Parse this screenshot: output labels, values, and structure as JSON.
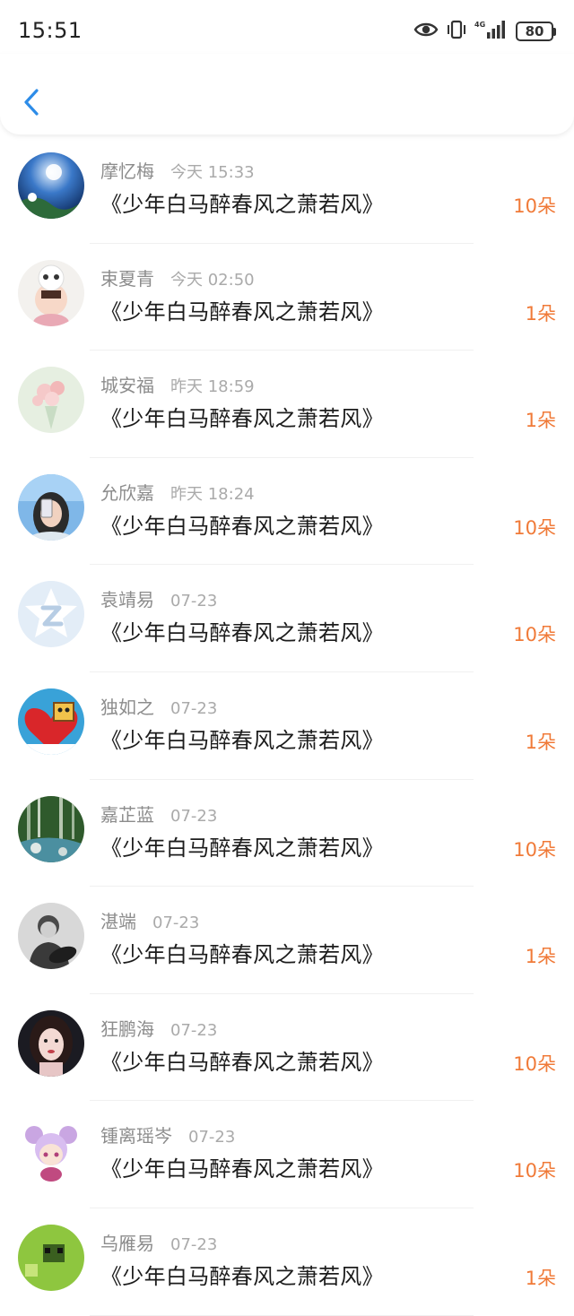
{
  "status_bar": {
    "time": "15:51",
    "battery": "80",
    "network": "4G"
  },
  "colors": {
    "accent_back": "#2d8ce8",
    "gift_count": "#f07a38",
    "meta_text": "#8c8c8c"
  },
  "nav": {
    "back_icon": "chevron-left-icon"
  },
  "items": [
    {
      "name": "摩忆梅",
      "time": "今天 15:33",
      "title": "《少年白马醉春风之萧若风》",
      "count": "10朵"
    },
    {
      "name": "束夏青",
      "time": "今天 02:50",
      "title": "《少年白马醉春风之萧若风》",
      "count": "1朵"
    },
    {
      "name": "城安福",
      "time": "昨天 18:59",
      "title": "《少年白马醉春风之萧若风》",
      "count": "1朵"
    },
    {
      "name": "允欣嘉",
      "time": "昨天 18:24",
      "title": "《少年白马醉春风之萧若风》",
      "count": "10朵"
    },
    {
      "name": "袁靖易",
      "time": "07-23",
      "title": "《少年白马醉春风之萧若风》",
      "count": "10朵"
    },
    {
      "name": "独如之",
      "time": "07-23",
      "title": "《少年白马醉春风之萧若风》",
      "count": "1朵"
    },
    {
      "name": "嘉芷蓝",
      "time": "07-23",
      "title": "《少年白马醉春风之萧若风》",
      "count": "10朵"
    },
    {
      "name": "湛端",
      "time": "07-23",
      "title": "《少年白马醉春风之萧若风》",
      "count": "1朵"
    },
    {
      "name": "狂鹏海",
      "time": "07-23",
      "title": "《少年白马醉春风之萧若风》",
      "count": "10朵"
    },
    {
      "name": "锺离瑶岑",
      "time": "07-23",
      "title": "《少年白马醉春风之萧若风》",
      "count": "10朵"
    },
    {
      "name": "乌雁易",
      "time": "07-23",
      "title": "《少年白马醉春风之萧若风》",
      "count": "1朵"
    }
  ]
}
